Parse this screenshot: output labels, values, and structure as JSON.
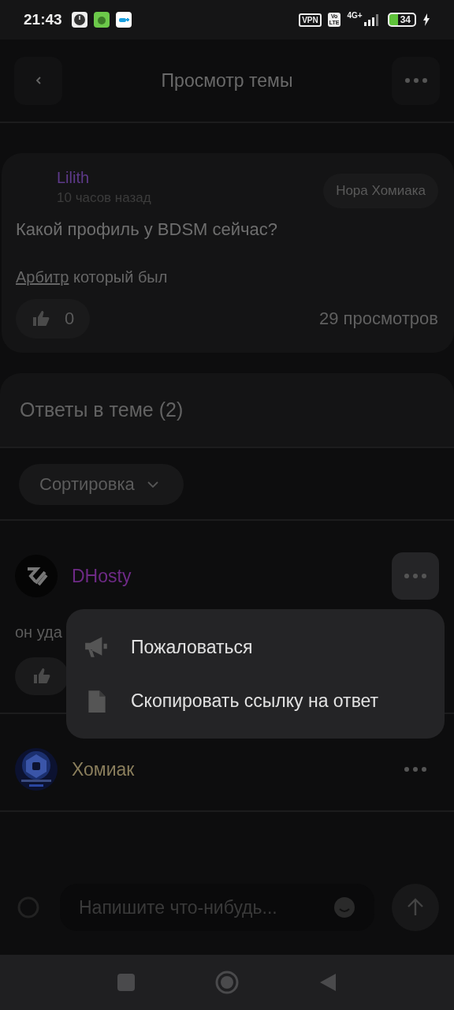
{
  "status_bar": {
    "time": "21:43",
    "vpn": "VPN",
    "volte_top": "Vo",
    "volte_bottom": "LTE",
    "network": "4G+",
    "battery": "34"
  },
  "header": {
    "title": "Просмотр темы"
  },
  "topic": {
    "author": "Lilith",
    "color": "#5e3a8a",
    "time": "10 часов назад",
    "tag": "Нора Хомиака",
    "title": "Какой профиль у BDSM сейчас?",
    "body_link": "Арбитр",
    "body_rest": "который был",
    "likes": "0",
    "views": "29 просмотров"
  },
  "replies_header": {
    "title": "Ответы в теме (2)"
  },
  "sort": {
    "label": "Сортировка"
  },
  "replies": [
    {
      "author": "DHosty",
      "color": "#6e2a86",
      "kind": "logo",
      "text": "он уда",
      "menu_open": true,
      "menu": [
        {
          "kind": "report",
          "label": "Пожаловаться"
        },
        {
          "kind": "copy",
          "label": "Скопировать ссылку на ответ"
        }
      ]
    },
    {
      "author": "Хомиак",
      "color": "#8a7e5c",
      "kind": "picture",
      "menu_open": false
    }
  ],
  "composer": {
    "placeholder": "Напишите что-нибудь..."
  }
}
